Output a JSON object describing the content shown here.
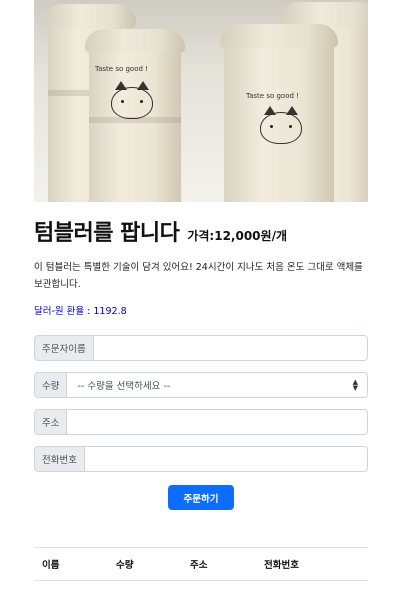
{
  "product": {
    "image_alt_icon": "tumbler-photo",
    "cup_text": "Taste so good !",
    "title": "텀블러를 팝니다",
    "price": "가격:12,000원/개",
    "description": "이 텀블러는 특별한 기술이 담겨 있어요! 24시간이 지나도 처음 온도 그대로 액체를 보관합니다.",
    "exchange_rate": "달러-원 환율 : 1192.8"
  },
  "form": {
    "name_label": "주문자이름",
    "name_value": "",
    "quantity_label": "수량",
    "quantity_selected": "-- 수량을 선택하세요 --",
    "address_label": "주소",
    "address_value": "",
    "phone_label": "전화번호",
    "phone_value": "",
    "submit_label": "주문하기"
  },
  "orders_table": {
    "headers": [
      "이름",
      "수량",
      "주소",
      "전화번호"
    ]
  },
  "colors": {
    "accent": "#0d6efd",
    "rate_text": "#0000cc",
    "addon_bg": "#e9ecef",
    "border": "#ced4da"
  }
}
